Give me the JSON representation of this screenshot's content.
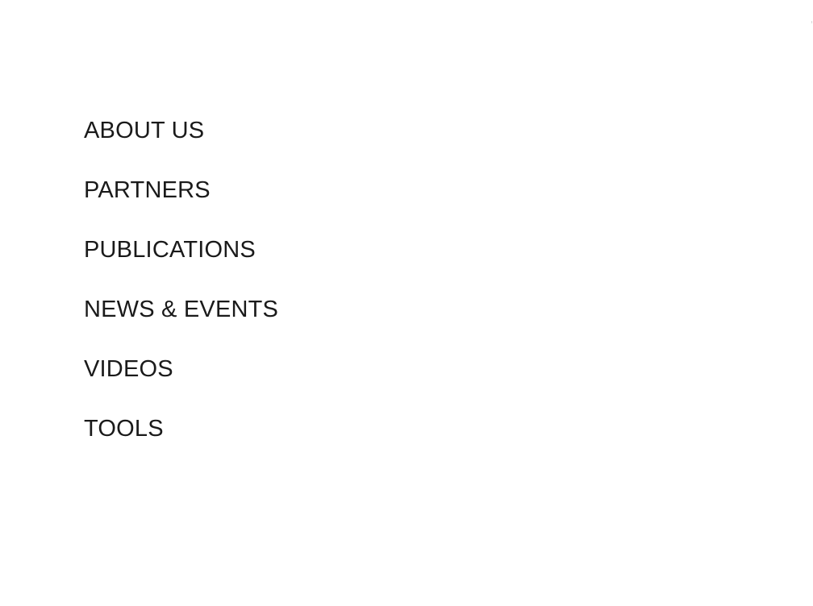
{
  "nav": {
    "items": [
      {
        "label": "ABOUT US"
      },
      {
        "label": "PARTNERS"
      },
      {
        "label": "PUBLICATIONS"
      },
      {
        "label": "NEWS & EVENTS"
      },
      {
        "label": "VIDEOS"
      },
      {
        "label": "TOOLS"
      }
    ]
  },
  "colors": {
    "background": "#ffffff",
    "text": "#1a1a1a"
  }
}
